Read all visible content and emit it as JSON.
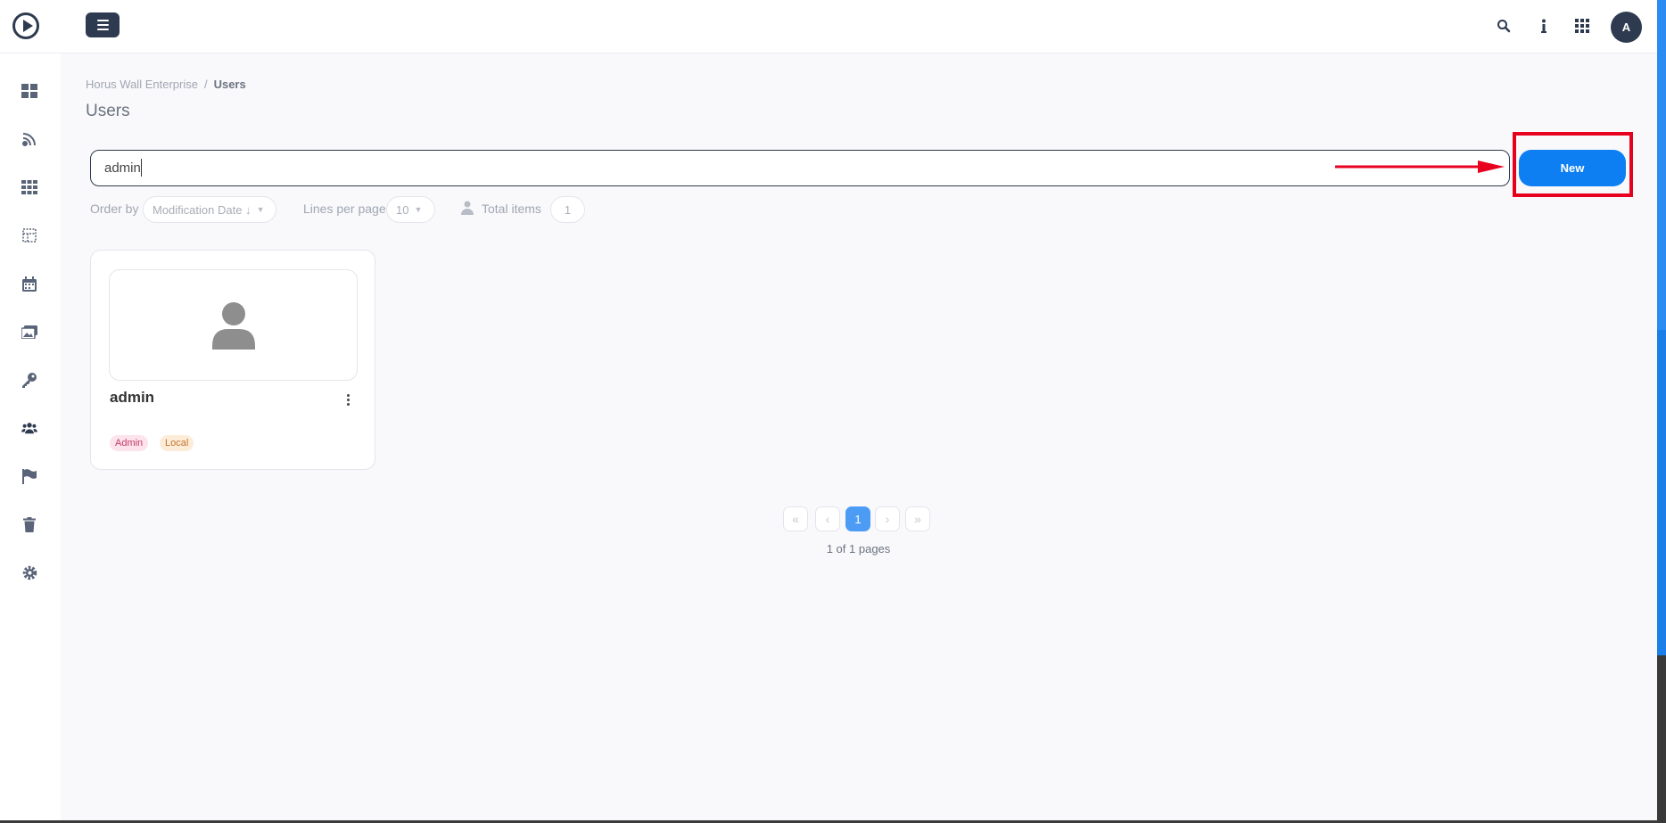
{
  "topbar": {
    "menu_button": "menu",
    "avatar_initial": "A",
    "icons": [
      "search-icon",
      "info-icon",
      "apps-grid-icon"
    ]
  },
  "sidebar": {
    "icons": [
      "dashboard-icon",
      "satellite-dish-icon",
      "grid-icon",
      "layout-icon",
      "calendar-icon",
      "images-icon",
      "key-icon",
      "users-icon",
      "flag-icon",
      "trash-icon",
      "gear-icon"
    ],
    "active": "users-icon"
  },
  "breadcrumb": {
    "root": "Horus Wall Enterprise",
    "separator": "/",
    "current": "Users"
  },
  "page": {
    "title": "Users"
  },
  "search": {
    "value": "admin"
  },
  "toolbar": {
    "new_label": "New"
  },
  "filters": {
    "order_by_label": "Order by",
    "order_by_value": "Modification Date ↓",
    "lines_per_page_label": "Lines per page",
    "lines_per_page_value": "10",
    "total_items_label": "Total items",
    "total_items_value": "1"
  },
  "cards": [
    {
      "name": "admin",
      "tags": [
        "Admin",
        "Local"
      ]
    }
  ],
  "pagination": {
    "first": "«",
    "prev": "‹",
    "current": "1",
    "next": "›",
    "last": "»",
    "info": "1 of 1 pages"
  },
  "colors": {
    "primary": "#0d7ff2",
    "dark": "#2e3a4f",
    "highlight": "#e8001f",
    "admin_tag": "#c33a6b",
    "local_tag": "#c2752e"
  }
}
